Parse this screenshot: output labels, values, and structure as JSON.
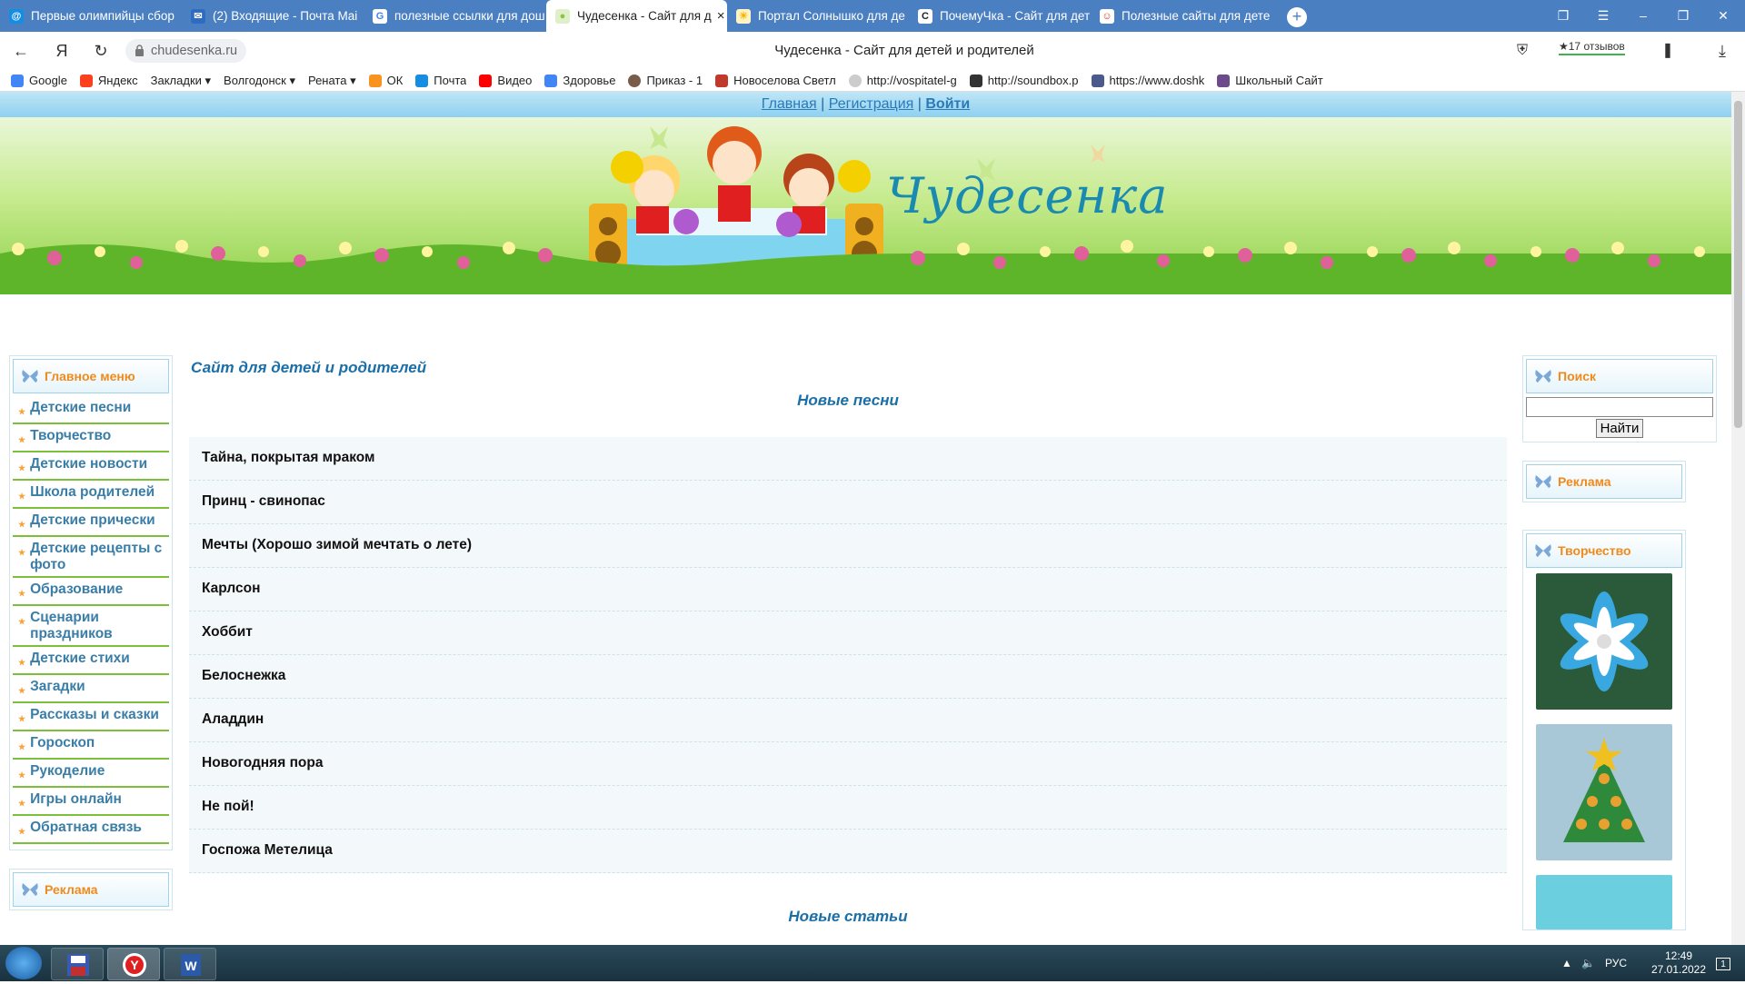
{
  "browser": {
    "tabs": [
      {
        "title": "Первые олимпийцы сбор",
        "color": "#fff",
        "glyph": "@"
      },
      {
        "title": "(2) Входящие - Почта Mai",
        "color": "#fff",
        "glyph": "✉"
      },
      {
        "title": "полезные ссылки для дош",
        "color": "#fff",
        "glyph": "G"
      },
      {
        "title": "Чудесенка - Сайт для д",
        "color": "#8bc34a",
        "glyph": "●"
      },
      {
        "title": "Портал Солнышко для де",
        "color": "#f5b400",
        "glyph": "☀"
      },
      {
        "title": "ПочемуЧка - Сайт для дет",
        "color": "#222",
        "glyph": "C"
      },
      {
        "title": "Полезные сайты для дете",
        "color": "#c0392b",
        "glyph": "☺"
      }
    ],
    "tab_close": "×",
    "new_tab": "+",
    "url": "chudesenka.ru",
    "page_title": "Чудесенка - Сайт для детей и родителей",
    "reviews": "★17 отзывов",
    "bookmarks": [
      {
        "label": "Google",
        "color": "#4285f4"
      },
      {
        "label": "Яндекс",
        "color": "#fc3f1d"
      },
      {
        "label": "Закладки ▾",
        "color": ""
      },
      {
        "label": "Волгодонск ▾",
        "color": ""
      },
      {
        "label": "Рената ▾",
        "color": ""
      },
      {
        "label": "ОК",
        "color": "#f7931e"
      },
      {
        "label": "Почта",
        "color": "#168de2"
      },
      {
        "label": "Видео",
        "color": "#ff0000"
      },
      {
        "label": "Здоровье",
        "color": "#4285f4"
      },
      {
        "label": "Приказ - 1",
        "color": "#7a5c4a"
      },
      {
        "label": "Новоселова Светл",
        "color": "#c0392b"
      },
      {
        "label": "http://vospitatel-g",
        "color": "#aaa"
      },
      {
        "label": "http://soundbox.p",
        "color": "#333"
      },
      {
        "label": "https://www.doshk",
        "color": "#4a5a8a"
      },
      {
        "label": "Школьный Сайт",
        "color": "#6b4b8a"
      }
    ]
  },
  "site": {
    "nav": {
      "home": "Главная",
      "sep1": "|",
      "register": "Регистрация",
      "sep2": "|",
      "login": "Войти"
    },
    "logo": "Чудесенка",
    "main_menu_title": "Главное меню",
    "main_menu": [
      "Детские песни",
      "Творчество",
      "Детские новости",
      "Школа родителей",
      "Детские прически",
      "Детские рецепты с фото",
      "Образование",
      "Сценарии праздников",
      "Детские стихи",
      "Загадки",
      "Рассказы и сказки",
      "Гороскоп",
      "Рукоделие",
      "Игры онлайн",
      "Обратная связь"
    ],
    "ads_title_left": "Реклама",
    "heading": "Сайт для детей и родителей",
    "songs_title": "Новые песни",
    "songs": [
      "Тайна, покрытая мраком",
      "Принц - свинопас",
      "Мечты (Хорошо зимой мечтать о лете)",
      "Карлсон",
      "Хоббит",
      "Белоснежка",
      "Аладдин",
      "Новогодняя пора",
      "Не пой!",
      "Госпожа Метелица"
    ],
    "articles_title": "Новые статьи",
    "search_title": "Поиск",
    "search_value": "",
    "search_button": "Найти",
    "ads_title_right": "Реклама",
    "creativity_title": "Творчество"
  },
  "taskbar": {
    "lang": "РУС",
    "time": "12:49",
    "date": "27.01.2022",
    "notif_count": "1"
  }
}
